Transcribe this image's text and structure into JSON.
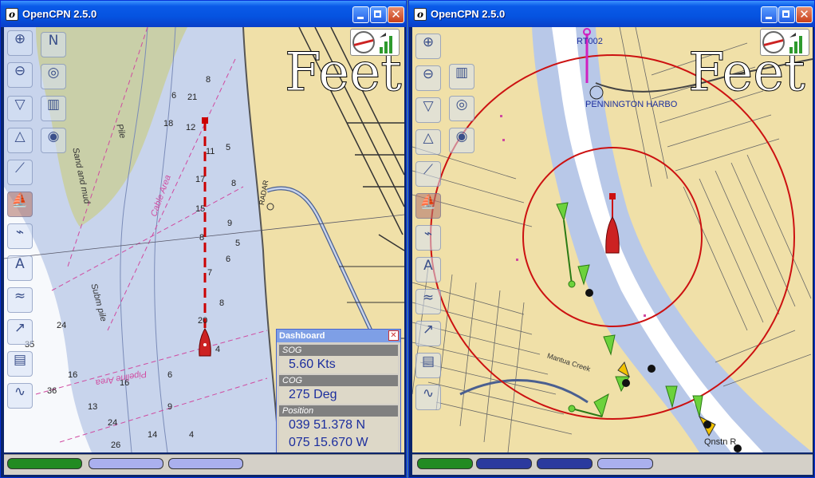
{
  "left_window": {
    "title": "OpenCPN 2.5.0",
    "chart_units": "Feet",
    "labels": {
      "sand_mud": "Sand and mud",
      "radar": "RADAR",
      "cable_area": "Cable Area",
      "pipeline_area": "Pipeline Area",
      "subm_pile": "Subm pile",
      "pile": "Pile"
    },
    "soundings": [
      "6",
      "8",
      "21",
      "18",
      "12",
      "11",
      "17",
      "15",
      "8",
      "7",
      "9",
      "8",
      "5",
      "5",
      "6",
      "8",
      "4",
      "20",
      "24",
      "26",
      "36",
      "35",
      "24",
      "16",
      "16",
      "13",
      "14",
      "9",
      "4",
      "6"
    ],
    "dashboard": {
      "title": "Dashboard",
      "sog_label": "SOG",
      "sog_value": "5.60 Kts",
      "cog_label": "COG",
      "cog_value": "275 Deg",
      "position_label": "Position",
      "lat_value": "039 51.378 N",
      "lon_value": "075 15.670 W"
    }
  },
  "right_window": {
    "title": "OpenCPN 2.5.0",
    "chart_units": "Feet",
    "labels": {
      "waypoint": "RT002",
      "harbor": "PENNINGTON HARBO",
      "creek": "Mantua Creek",
      "bottom_label": "Qnstn R"
    }
  },
  "toolbar_icons": [
    "zoom-in-icon",
    "zoom-out-icon",
    "scale-in-icon",
    "scale-out-icon",
    "route-icon",
    "track-icon",
    "text-icon",
    "tide-icon",
    "current-icon",
    "print-icon",
    "settings-icon"
  ],
  "colors": {
    "land": "#f0e0a8",
    "water": "#c8d4ec",
    "shallow": "#ffffff",
    "route": "#cc0000",
    "status_green": "#228b22",
    "status_light": "#aab0ee",
    "status_dark": "#2b3a9e"
  }
}
